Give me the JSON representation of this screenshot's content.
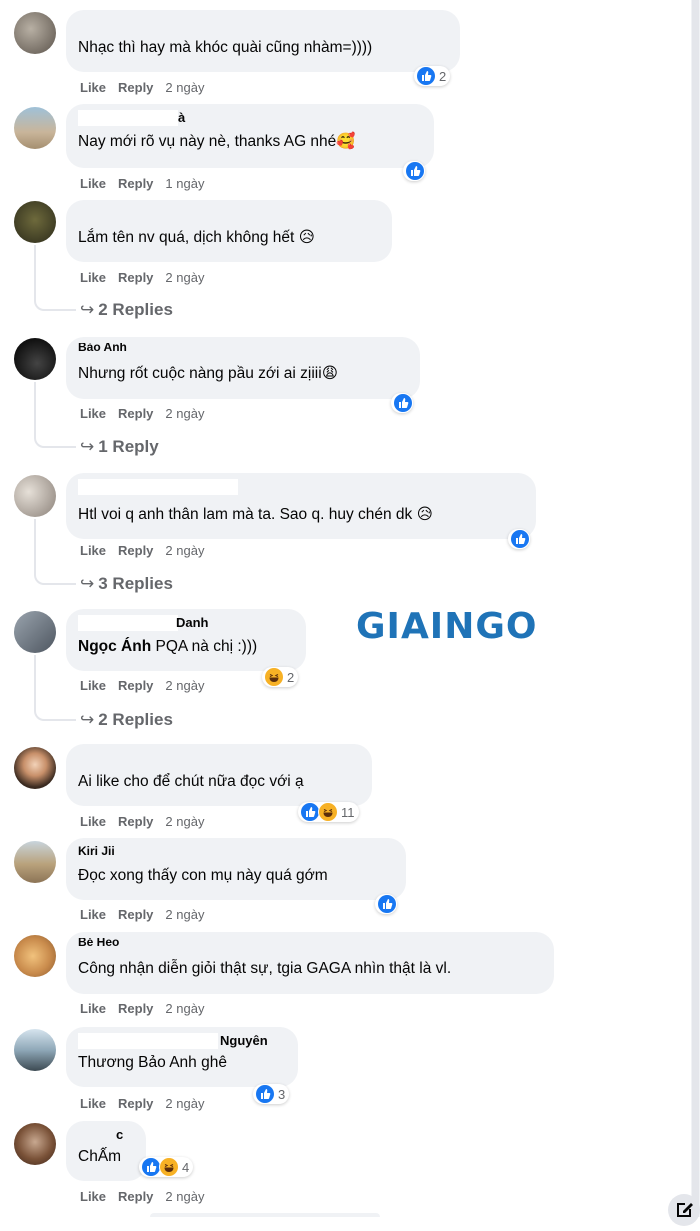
{
  "actions": {
    "like": "Like",
    "reply": "Reply"
  },
  "watermark": "GIAINGO",
  "comments": [
    {
      "name": "",
      "text": "Nhạc thì hay mà khóc quài cũng nhàm=))))",
      "time": "2 ngày",
      "reaction_count": "2",
      "reactions": [
        "like"
      ]
    },
    {
      "name": "à",
      "text": "Nay mới rõ vụ này nè, thanks AG nhé🥰",
      "time": "1 ngày",
      "reaction_count": "",
      "reactions": [
        "like"
      ]
    },
    {
      "name": "",
      "text": "Lắm tên nv quá, dịch không hết 😥",
      "time": "2 ngày",
      "reaction_count": "",
      "reactions": [],
      "replies": "2 Replies"
    },
    {
      "name": "Bảo Anh",
      "text": "Nhưng rốt cuộc nàng pầu zới ai zịiii😩",
      "time": "2 ngày",
      "reaction_count": "",
      "reactions": [
        "like"
      ],
      "replies": "1 Reply"
    },
    {
      "name": "",
      "text": "Htl voi q anh thân lam mà ta. Sao q. huy chén dk 😥",
      "time": "2 ngày",
      "reaction_count": "",
      "reactions": [
        "like"
      ],
      "replies": "3 Replies"
    },
    {
      "name": "Danh",
      "text_bold": "Ngọc Ánh",
      "text": " PQA nà chị :)))",
      "time": "2 ngày",
      "reaction_count": "2",
      "reactions": [
        "haha"
      ],
      "replies": "2 Replies"
    },
    {
      "name": "",
      "text": "Ai like cho để chút nữa đọc với ạ",
      "time": "2 ngày",
      "reaction_count": "11",
      "reactions": [
        "like",
        "haha"
      ]
    },
    {
      "name": "Kiri Jii",
      "text": "Đọc xong thấy con mụ này quá gớm",
      "time": "2 ngày",
      "reaction_count": "",
      "reactions": [
        "like"
      ]
    },
    {
      "name": "Bé Heo",
      "text": "Công nhận diễn giỏi thật sự, tgia GAGA nhìn thật là vl.",
      "time": "2 ngày",
      "reaction_count": "",
      "reactions": []
    },
    {
      "name": "Nguyên",
      "text": "Thương Bảo Anh ghê",
      "time": "2 ngày",
      "reaction_count": "3",
      "reactions": [
        "like"
      ]
    },
    {
      "name": "c",
      "text": "ChẤm",
      "time": "2 ngày",
      "reaction_count": "4",
      "reactions": [
        "like",
        "haha"
      ]
    }
  ],
  "colors": {
    "bubble": "#f0f2f5",
    "meta_text": "#65676b",
    "like_blue": "#1877f2",
    "haha_yellow": "#f7b125",
    "watermark_blue": "#1f73b7"
  },
  "icons": {
    "like": "like-reaction-icon",
    "haha": "haha-reaction-icon",
    "reply_arrow": "reply-arrow-icon",
    "edit": "compose-icon"
  }
}
